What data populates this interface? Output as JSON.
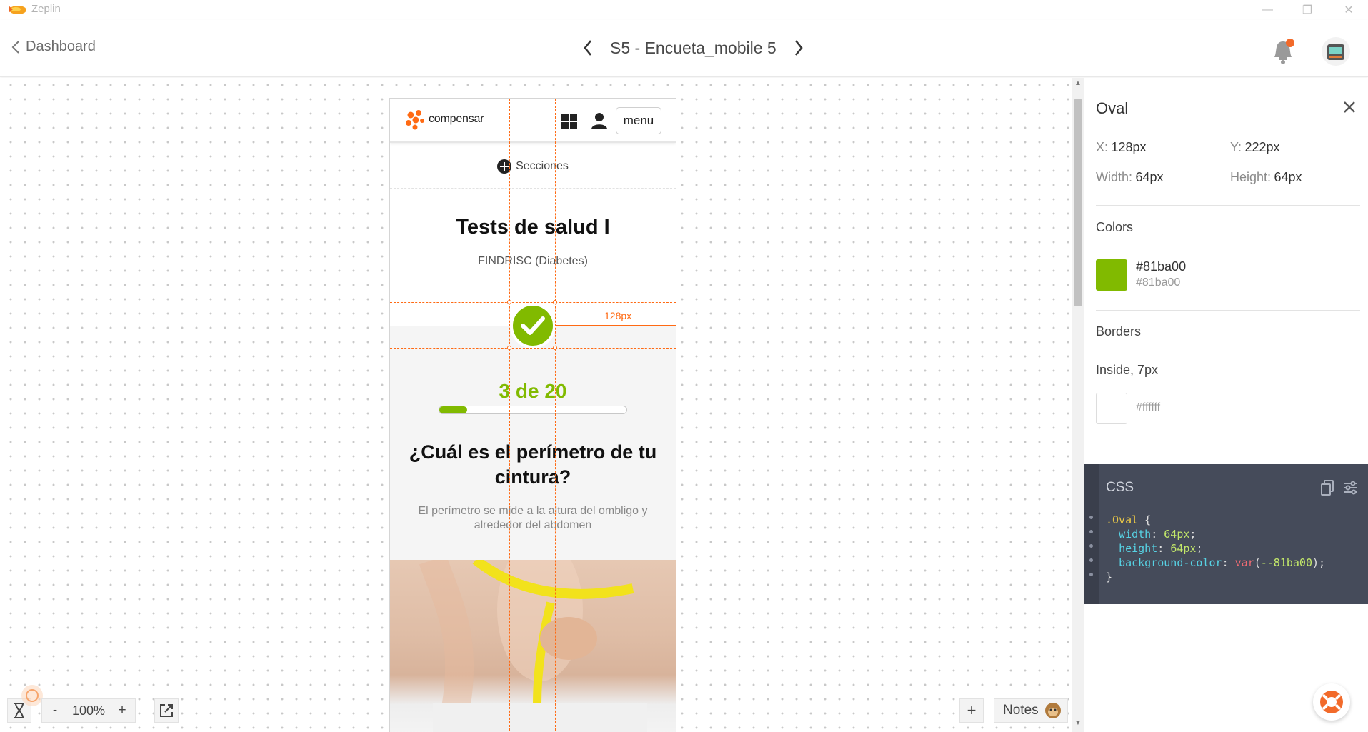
{
  "app": {
    "name": "Zeplin"
  },
  "header": {
    "back_label": "Dashboard",
    "screen_title": "S5 - Encueta_mobile 5"
  },
  "artboard": {
    "brand": "compensar",
    "menu_label": "menu",
    "sections_label": "Secciones",
    "title": "Tests de salud I",
    "subtitle": "FINDRISC (Diabetes)",
    "progress_text": "3 de 20",
    "progress_fraction": 0.15,
    "question": "¿Cuál es el perímetro de tu cintura?",
    "hint": "El perímetro se mide a la altura del ombligo y alrededor del abdomen",
    "measure_label": "128px"
  },
  "canvas_controls": {
    "zoom": "100%",
    "zoom_out": "-",
    "zoom_in": "+",
    "add": "+",
    "notes": "Notes"
  },
  "inspector": {
    "layer_name": "Oval",
    "x_label": "X:",
    "x_value": "128px",
    "y_label": "Y:",
    "y_value": "222px",
    "width_label": "Width:",
    "width_value": "64px",
    "height_label": "Height:",
    "height_value": "64px",
    "colors_title": "Colors",
    "color_hex": "#81ba00",
    "color_name": "#81ba00",
    "borders_title": "Borders",
    "border_desc": "Inside, 7px",
    "border_color": "#ffffff",
    "css_title": "CSS",
    "css_selector": ".Oval",
    "css_width_prop": "width",
    "css_width_val": "64px",
    "css_height_prop": "height",
    "css_height_val": "64px",
    "css_bg_prop": "background-color",
    "css_bg_fn": "var",
    "css_bg_var": "--81ba00"
  },
  "colors": {
    "accent": "#81ba00",
    "measure": "#ff6a13",
    "css_bg": "#454b5a"
  }
}
